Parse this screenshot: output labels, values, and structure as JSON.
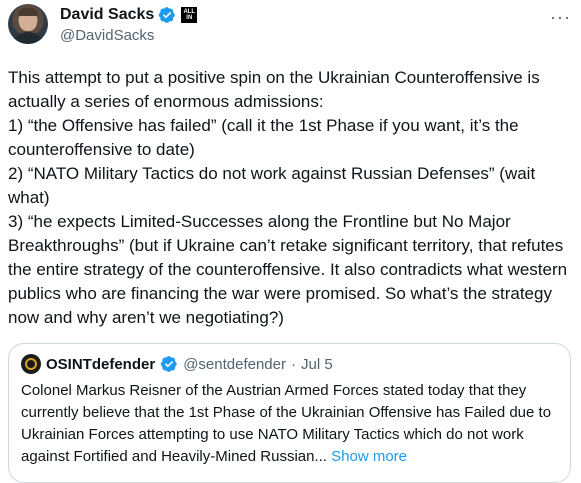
{
  "author": {
    "display_name": "David Sacks",
    "handle": "@DavidSacks",
    "affiliate_badge": "ALL IN"
  },
  "tweet": {
    "intro": "This attempt to put a positive spin on the Ukrainian Counteroffensive is actually a series of enormous admissions:",
    "point1": "1) “the Offensive has failed” (call it the 1st Phase if you want, it’s the counteroffensive to date)",
    "point2": "2) “NATO Military Tactics do not work against Russian Defenses” (wait what)",
    "point3": "3) “he expects Limited-Successes along the Frontline but No Major Breakthroughs” (but if Ukraine can’t retake significant territory, that refutes the entire strategy of the counteroffensive. It also contradicts what western publics who are financing the war were promised. So what’s the strategy now and why aren’t we negotiating?)"
  },
  "quote": {
    "display_name": "OSINTdefender",
    "handle": "@sentdefender",
    "separator": "·",
    "date": "Jul 5",
    "text": "Colonel Markus Reisner of the Austrian Armed Forces stated today that they currently believe that the 1st Phase of the Ukrainian Offensive has Failed due to Ukrainian Forces attempting to use NATO Military Tactics which do not work against Fortified and Heavily-Mined Russian...",
    "show_more": "Show more"
  },
  "colors": {
    "text": "#0f1419",
    "secondary": "#536471",
    "link": "#1d9bf0",
    "verified": "#1d9bf0",
    "border": "#cfd9de"
  },
  "icons": [
    "verified-badge-icon",
    "more-options-icon"
  ]
}
